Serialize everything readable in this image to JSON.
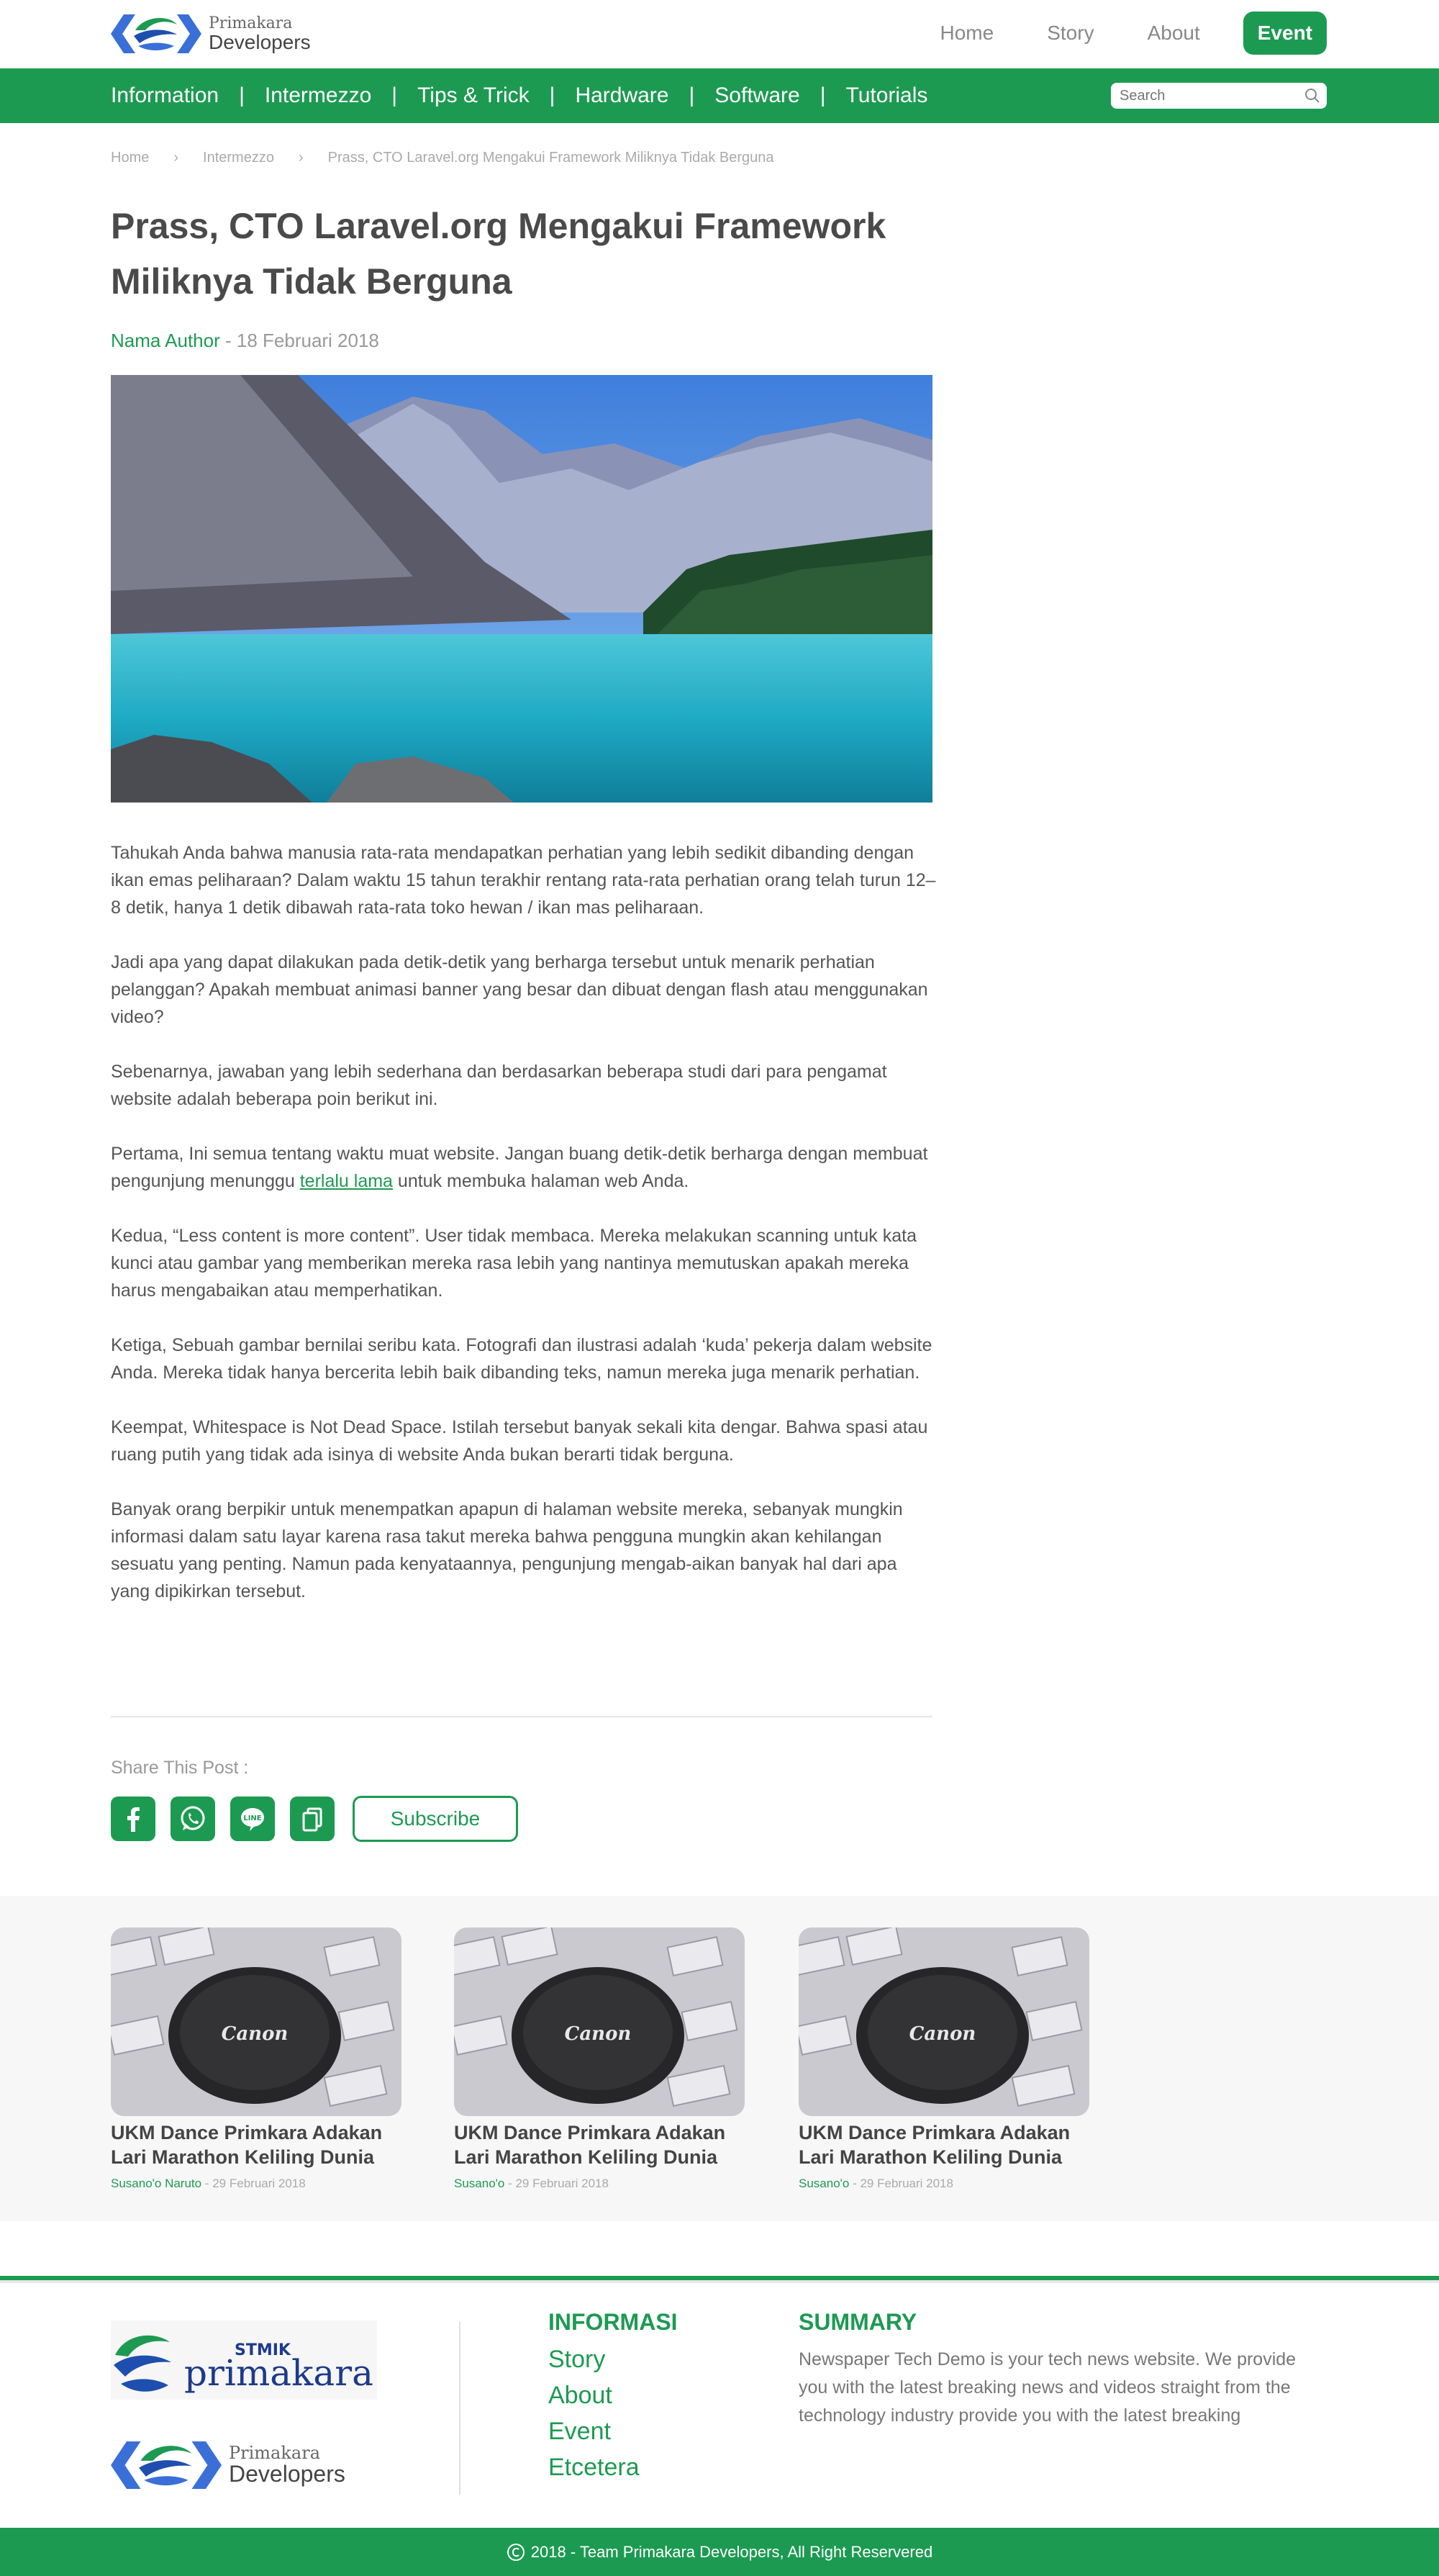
{
  "header": {
    "logo_line1": "Primakara",
    "logo_line2": "Developers",
    "nav": [
      "Home",
      "Story",
      "About"
    ],
    "event_label": "Event"
  },
  "categories": [
    "Information",
    "Intermezzo",
    "Tips & Trick",
    "Hardware",
    "Software",
    "Tutorials"
  ],
  "search": {
    "placeholder": "Search"
  },
  "breadcrumb": [
    "Home",
    "Intermezzo",
    "Prass, CTO Laravel.org Mengakui Framework Miliknya Tidak Berguna"
  ],
  "article": {
    "title": "Prass, CTO Laravel.org Mengakui Framework Miliknya Tidak Berguna",
    "author": "Nama Author",
    "date": "18 Februari 2018",
    "paragraphs": [
      "Tahukah Anda bahwa manusia rata-rata mendapatkan perhatian yang lebih sedikit dibanding dengan ikan emas peliharaan? Dalam waktu 15 tahun terakhir rentang rata-rata perhatian orang telah turun 12–8 detik, hanya 1 detik dibawah rata-rata toko hewan / ikan mas peliharaan.",
      "Jadi apa yang dapat dilakukan pada detik-detik yang berharga tersebut untuk menarik perhatian pelanggan? Apakah membuat animasi banner yang besar dan dibuat dengan flash atau menggunakan video?",
      "Sebenarnya, jawaban yang lebih sederhana dan berdasarkan beberapa studi dari para pengamat website adalah beberapa poin berikut ini."
    ],
    "p4_before": "Pertama, Ini semua tentang waktu muat website. Jangan buang detik-detik berharga dengan membuat pengunjung menunggu ",
    "p4_link": "terlalu lama",
    "p4_after": " untuk membuka halaman web Anda.",
    "paragraphs_rest": [
      "Kedua, “Less content is more content”. User tidak membaca. Mereka melakukan scanning untuk kata kunci atau gambar yang memberikan mereka rasa lebih yang nantinya memutuskan apakah mereka harus mengabaikan atau memperhatikan.",
      "Ketiga, Sebuah gambar bernilai seribu kata. Fotografi dan ilustrasi adalah ‘kuda’ pekerja dalam website Anda. Mereka tidak hanya bercerita lebih baik dibanding teks, namun mereka juga menarik perhatian.",
      "Keempat, Whitespace is Not Dead Space. Istilah tersebut banyak sekali kita dengar. Bahwa spasi atau ruang putih yang tidak ada isinya di website Anda bukan berarti tidak berguna.",
      "Banyak orang berpikir untuk menempatkan apapun di halaman website mereka, sebanyak mungkin informasi dalam satu layar karena rasa takut mereka bahwa pengguna mungkin akan kehilangan sesuatu yang penting. Namun pada kenyataannya, pengunjung mengab-aikan banyak hal dari apa yang dipikirkan tersebut."
    ]
  },
  "share": {
    "label": "Share This Post :",
    "icons": [
      "facebook-icon",
      "whatsapp-icon",
      "line-icon",
      "copy-icon"
    ],
    "subscribe_label": "Subscribe"
  },
  "related": [
    {
      "title": "UKM Dance Primkara Adakan Lari Marathon Keliling Dunia",
      "author": "Susano'o Naruto",
      "date": "- 29 Februari 2018"
    },
    {
      "title": "UKM Dance Primkara Adakan Lari Marathon Keliling Dunia",
      "author": "Susano'o",
      "date": "- 29 Februari 2018"
    },
    {
      "title": "UKM Dance Primkara Adakan Lari Marathon Keliling Dunia",
      "author": "Susano'o",
      "date": "- 29 Februari 2018"
    }
  ],
  "footer": {
    "stmik_line1": "STMIK",
    "stmik_line2": "primakara",
    "informasi_heading": "INFORMASI",
    "informasi_links": [
      "Story",
      "About",
      "Event",
      "Etcetera"
    ],
    "summary_heading": "SUMMARY",
    "summary_text": "Newspaper Tech Demo is your tech news website. We provide you with the latest breaking news and videos straight from the technology industry provide you with the latest breaking",
    "copyright": "2018 -  Team Primakara Developers, All Right Reservered"
  },
  "colors": {
    "brand_green": "#1d9a52",
    "text": "#555555",
    "muted": "#999999"
  }
}
